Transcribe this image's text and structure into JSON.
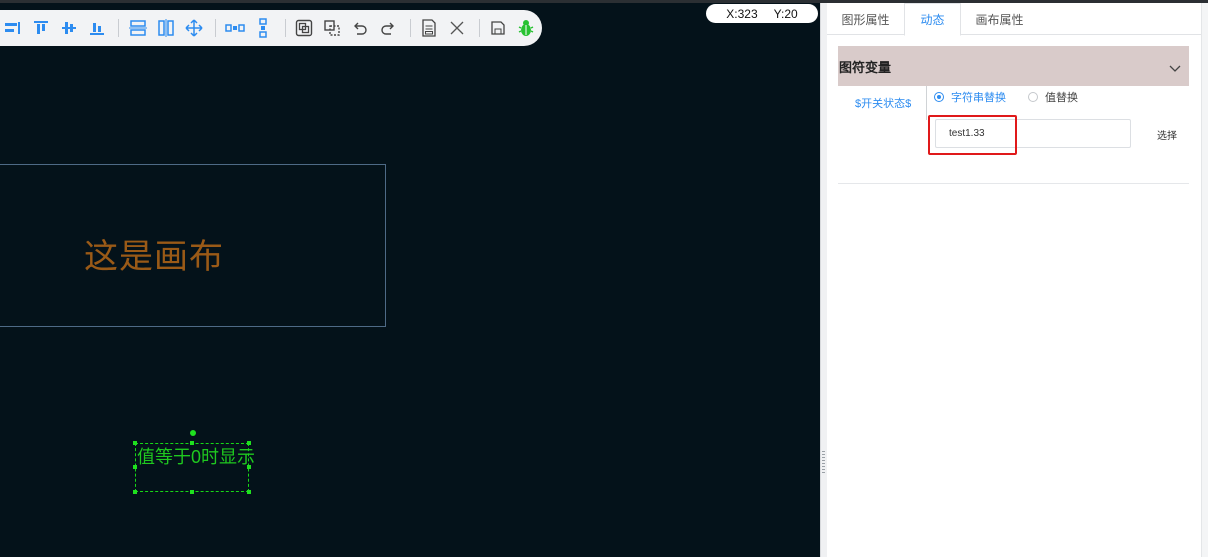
{
  "coords": {
    "x": "X:323",
    "y": "Y:20"
  },
  "canvas": {
    "label": "这是画布",
    "selected_text": "值等于0时显示"
  },
  "toolbar": {
    "icons": [
      "align-left-icon",
      "align-top-icon",
      "align-middle-icon",
      "align-bottom-icon",
      "distribute-vertical-icon",
      "distribute-horizontal-icon",
      "move-icon",
      "group-horizontal-icon",
      "group-vertical-icon",
      "combine-icon",
      "ungroup-icon",
      "undo-icon",
      "redo-icon",
      "document-icon",
      "close-icon",
      "save-icon",
      "debug-bug-icon"
    ]
  },
  "panel": {
    "tabs": [
      {
        "label": "图形属性",
        "active": false
      },
      {
        "label": "动态",
        "active": true
      },
      {
        "label": "画布属性",
        "active": false
      }
    ],
    "section_title": "图符变量",
    "variable_name": "$开关状态$",
    "radio_options": [
      {
        "label": "字符串替换",
        "checked": true
      },
      {
        "label": "值替换",
        "checked": false
      }
    ],
    "input_value": "test1.33",
    "choose_button": "选择"
  },
  "colors": {
    "canvas_bg": "#04121a",
    "accent_blue": "#2d8cf0",
    "canvas_label": "#9a5a17",
    "selection_green": "#1fc81f",
    "highlight_red": "#e0191a",
    "section_header_bg": "#d9cbca"
  }
}
